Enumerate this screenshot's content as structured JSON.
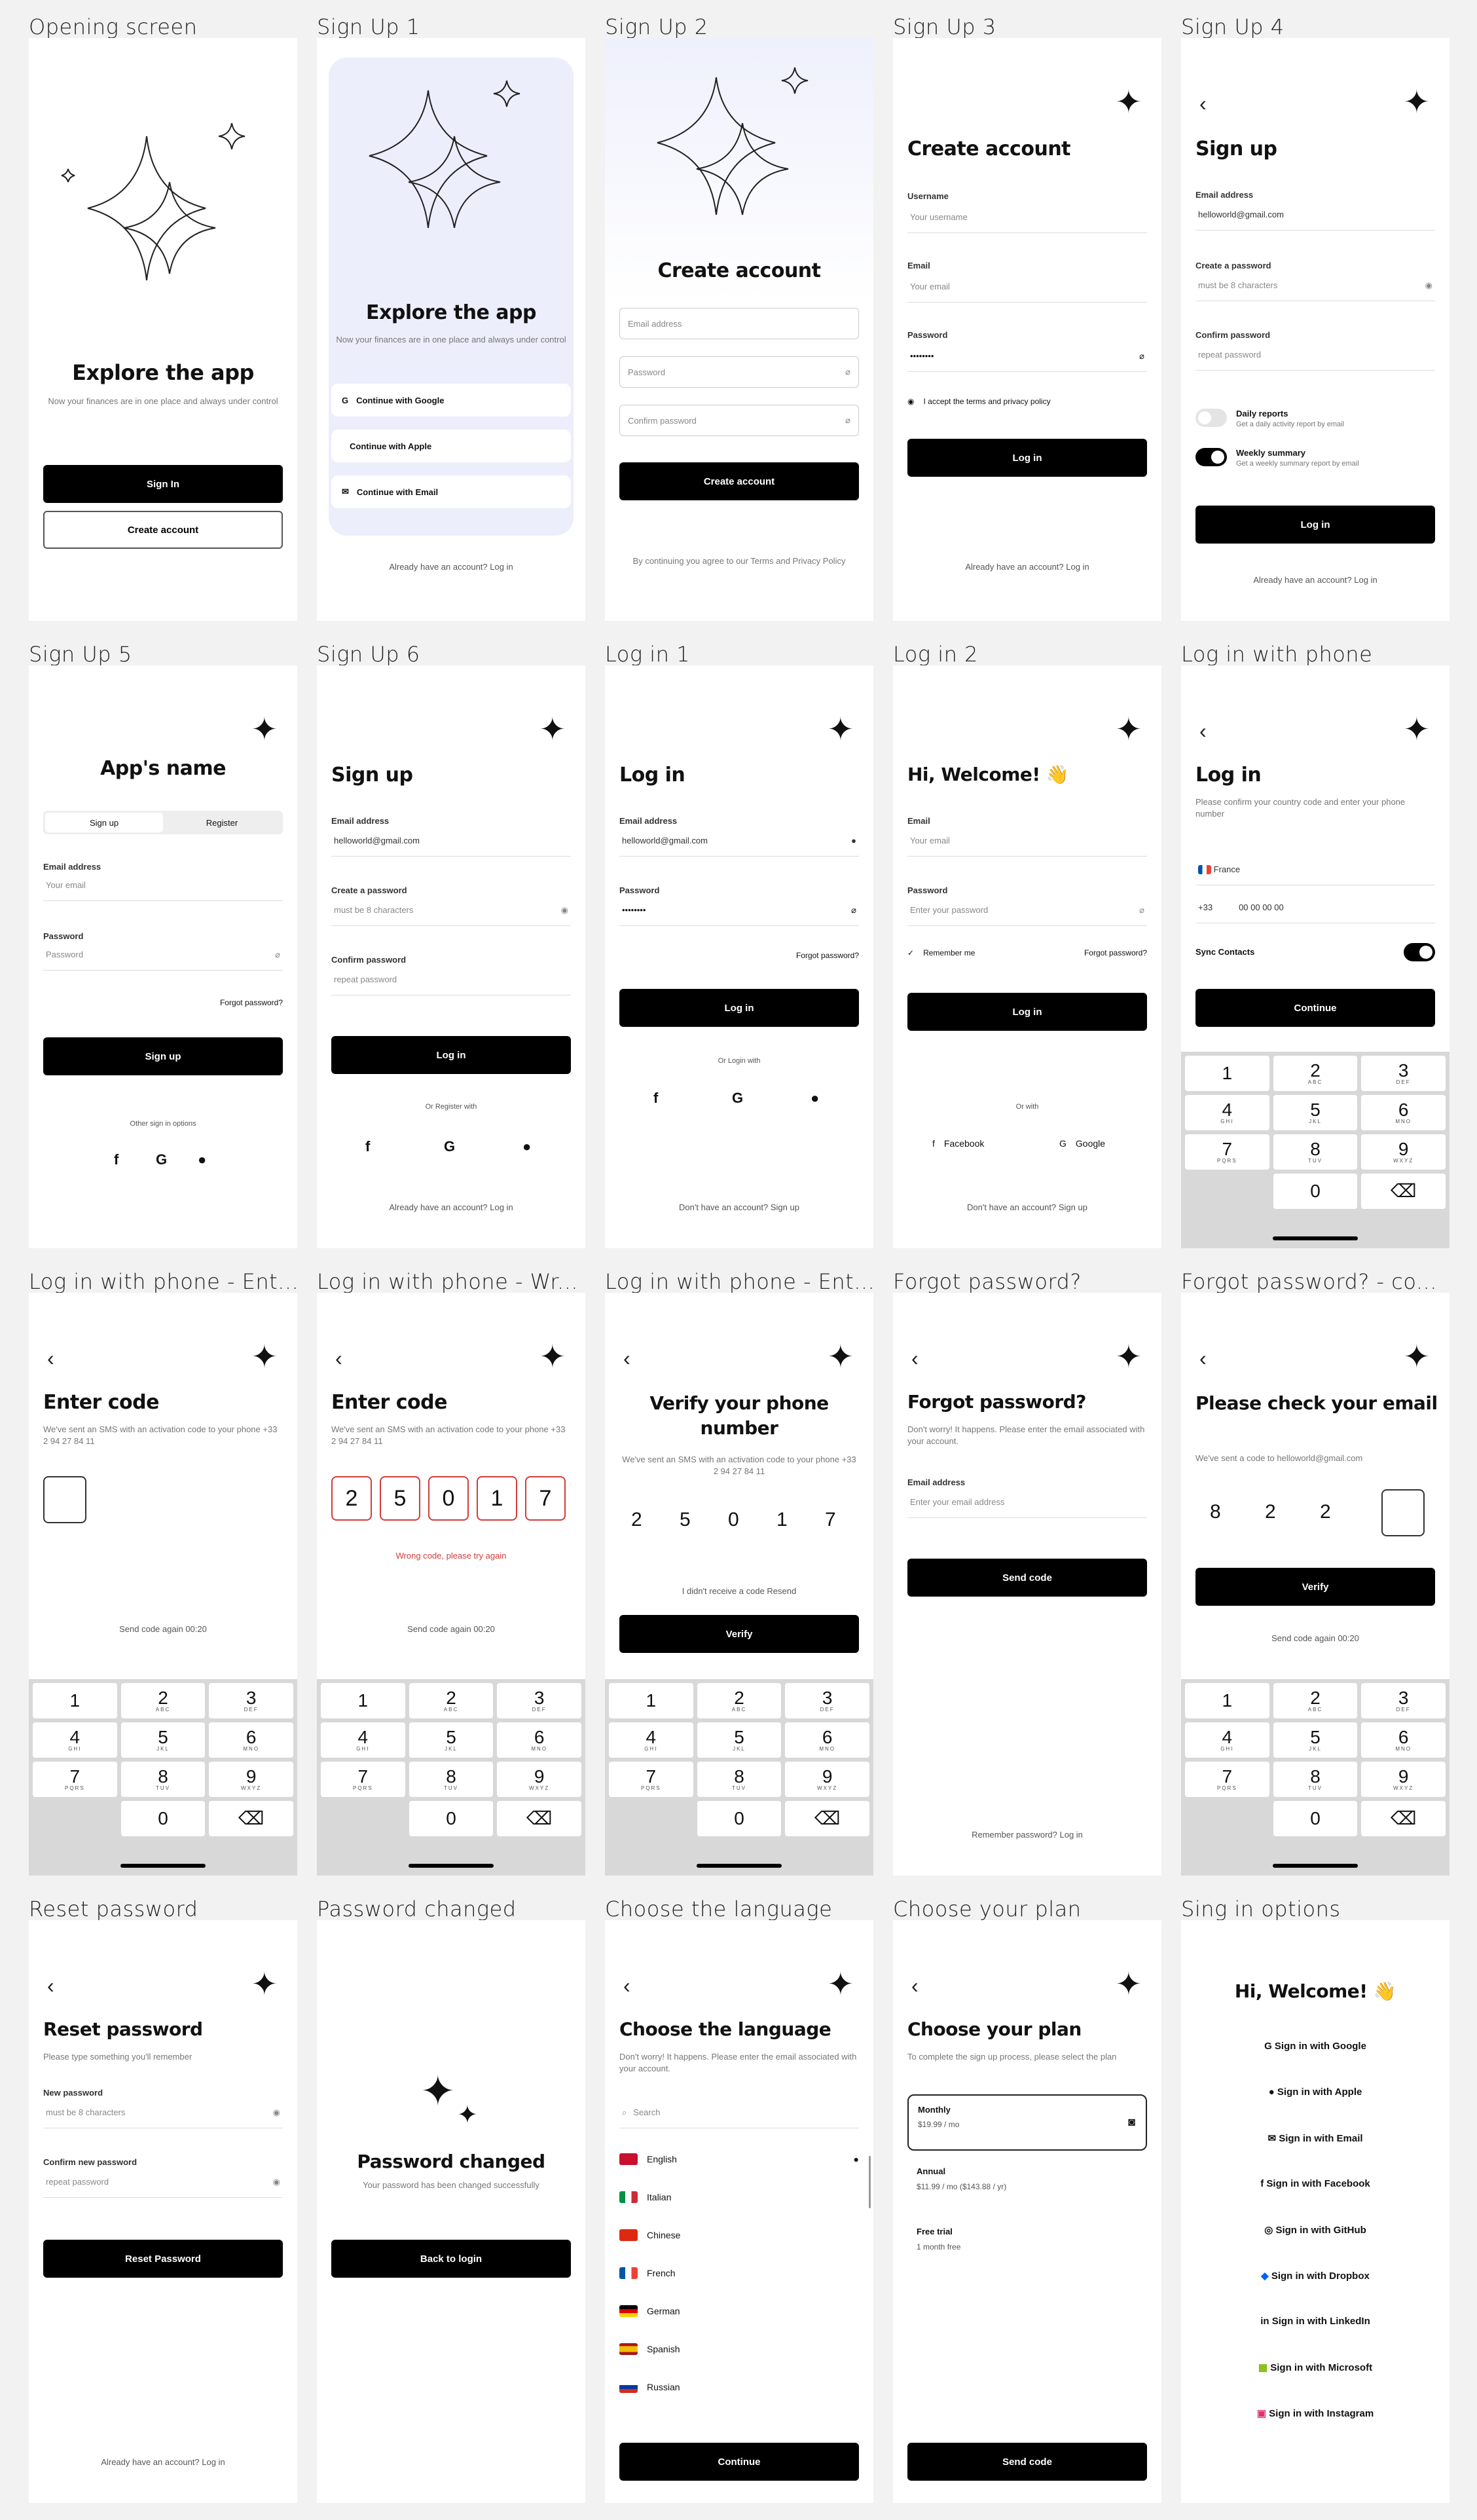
{
  "captions": [
    "Opening screen",
    "Sign Up 1",
    "Sign Up 2",
    "Sign Up 3",
    "Sign Up 4",
    "Sign Up 5",
    "Sign Up 6",
    "Log in 1",
    "Log in 2",
    "Log in with phone",
    "Log in with phone - Ent...",
    "Log in with phone - Wr...",
    "Log in with phone - Ent...",
    "Forgot password?",
    "Forgot password? - co...",
    "Reset password",
    "Password changed",
    "Choose the language",
    "Choose your plan",
    "Sing in options"
  ],
  "common": {
    "sparkle": "✦",
    "back": "‹",
    "dont_have": "Don't have an account? Sign up",
    "already": "Already have an account? Log in",
    "login": "Log in",
    "signup": "Sign up"
  },
  "s1": {
    "title": "Explore the app",
    "sub": "Now your finances are in one place and always under control",
    "signin": "Sign In",
    "create": "Create account"
  },
  "s2": {
    "title": "Explore the app",
    "sub": "Now your finances are in one place and always under control",
    "google": "Continue with Google",
    "apple": "Continue with Apple",
    "email": "Continue with Email",
    "footer": "Already have an account? Log in"
  },
  "s3": {
    "title": "Create account",
    "email": "Email address",
    "password": "Password",
    "confirm": "Confirm password",
    "btn": "Create account",
    "footer": "By continuing you agree to our Terms and Privacy Policy"
  },
  "s4": {
    "title": "Create account",
    "username": "Username",
    "username_ph": "Your username",
    "email": "Email",
    "email_ph": "Your email",
    "password": "Password",
    "password_val": "••••••••",
    "agree": "I accept the terms and privacy policy",
    "btn": "Log in",
    "footer": "Already have an account? Log in"
  },
  "s5": {
    "title": "Sign up",
    "email": "Email address",
    "email_val": "helloworld@gmail.com",
    "password": "Create a password",
    "password_ph": "must be 8 characters",
    "confirm": "Confirm password",
    "confirm_ph": "repeat password",
    "t1": "Daily reports",
    "t1s": "Get a daily activity report by email",
    "t2": "Weekly summary",
    "t2s": "Get a weekly summary report by email",
    "btn": "Log in",
    "footer": "Already have an account? Log in"
  },
  "s6": {
    "title": "App's name",
    "tab1": "Sign up",
    "tab2": "Register",
    "email": "Email address",
    "email_ph": "Your email",
    "password": "Password",
    "password_ph": "Password",
    "forgot": "Forgot password?",
    "btn": "Sign up",
    "other": "Other sign in options"
  },
  "s7": {
    "title": "Sign up",
    "email": "Email address",
    "email_val": "helloworld@gmail.com",
    "password": "Create a password",
    "password_ph": "must be 8 characters",
    "confirm": "Confirm password",
    "confirm_ph": "repeat password",
    "btn": "Log in",
    "or": "Or Register with",
    "footer": "Already have an account? Log in"
  },
  "s8": {
    "title": "Log in",
    "email": "Email address",
    "email_val": "helloworld@gmail.com",
    "password": "Password",
    "password_val": "••••••••",
    "forgot": "Forgot password?",
    "btn": "Log in",
    "or": "Or Login with",
    "footer": "Don't have an account? Sign up"
  },
  "s9": {
    "title": "Hi, Welcome! 👋",
    "email": "Email",
    "email_ph": "Your email",
    "password": "Password",
    "password_ph": "Enter your password",
    "remember": "Remember me",
    "forgot": "Forgot password?",
    "btn": "Log in",
    "or": "Or with",
    "facebook": "Facebook",
    "google": "Google",
    "footer": "Don't have an account? Sign up"
  },
  "s10": {
    "title": "Log in",
    "sub": "Please confirm your country code and enter your phone number",
    "country": "France",
    "code": "+33",
    "phone": "00 00 00 00",
    "sync": "Sync Contacts",
    "btn": "Continue"
  },
  "s11": {
    "title": "Enter code",
    "sub": "We've sent an SMS with an activation code to your phone +33 2 94 27 84 11",
    "resend": "Send code again 00:20"
  },
  "s12": {
    "title": "Enter code",
    "sub": "We've sent an SMS with an activation code to your phone +33 2 94 27 84 11",
    "digits": [
      "2",
      "5",
      "0",
      "1",
      "7"
    ],
    "error": "Wrong code, please try again",
    "resend": "Send code again 00:20"
  },
  "s13": {
    "title": "Verify your phone number",
    "sub": "We've sent an SMS with an activation code to your phone +33 2 94 27 84 11",
    "digits": [
      "2",
      "5",
      "0",
      "1",
      "7"
    ],
    "resend": "I didn't receive a code Resend",
    "btn": "Verify"
  },
  "s14": {
    "title": "Forgot password?",
    "sub": "Don't worry! It happens. Please enter the email associated with your account.",
    "email": "Email address",
    "email_ph": "Enter your email address",
    "btn": "Send code",
    "footer": "Remember password? Log in"
  },
  "s15": {
    "title": "Please check your email",
    "sub": "We've sent a code to helloworld@gmail.com",
    "digits": [
      "8",
      "2",
      "2",
      ""
    ],
    "btn": "Verify",
    "resend": "Send code again 00:20"
  },
  "s16": {
    "title": "Reset password",
    "sub": "Please type something you'll remember",
    "newpw": "New password",
    "newpw_ph": "must be 8 characters",
    "confirm": "Confirm new password",
    "confirm_ph": "repeat password",
    "btn": "Reset Password",
    "footer": "Already have an account? Log in"
  },
  "s17": {
    "title": "Password changed",
    "sub": "Your password has been changed successfully",
    "btn": "Back to login"
  },
  "s18": {
    "title": "Choose the language",
    "sub": "Don't worry! It happens. Please enter the email associated with your account.",
    "search": "Search",
    "langs": [
      "English",
      "Italian",
      "Chinese",
      "French",
      "German",
      "Spanish",
      "Russian"
    ],
    "btn": "Continue"
  },
  "s19": {
    "title": "Choose your plan",
    "sub": "To complete the sign up process, please select the plan",
    "monthly": "Monthly",
    "monthly_price": "$19.99 / mo",
    "annual": "Annual",
    "annual_price": "$11.99 / mo ($143.88 / yr)",
    "trial": "Free trial",
    "trial_sub": "1 month free",
    "btn": "Send code"
  },
  "s20": {
    "title": "Hi, Welcome! 👋",
    "options": [
      "Sign in with Google",
      "Sign in with Apple",
      "Sign in with Email",
      "Sign in with Facebook",
      "Sign in with GitHub",
      "Sign in with Dropbox",
      "Sign in with LinkedIn",
      "Sign in with Microsoft",
      "Sign in with Instagram"
    ]
  },
  "keypad": {
    "keys": [
      "1",
      "2",
      "3",
      "4",
      "5",
      "6",
      "7",
      "8",
      "9",
      "",
      "0",
      "⌫"
    ],
    "subs": [
      "",
      "ABC",
      "DEF",
      "GHI",
      "JKL",
      "MNO",
      "PQRS",
      "TUV",
      "WXYZ",
      "",
      "",
      ""
    ]
  },
  "colors": {
    "tint": "#eceefc",
    "error": "#d23c3c",
    "black": "#000000"
  }
}
